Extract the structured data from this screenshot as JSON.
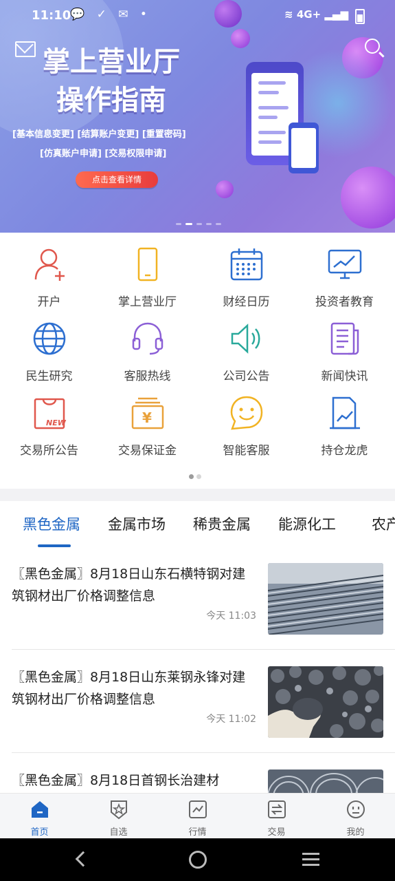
{
  "status_bar": {
    "time": "11:10",
    "left_icons": "💬 ✓ ✉ •",
    "network": "4G+"
  },
  "banner": {
    "title_line1": "掌上营业厅",
    "title_line2": "操作指南",
    "tags_row1": "[基本信息变更] [结算账户变更] [重置密码]",
    "tags_row2": "[仿真账户申请]   [交易权限申请]",
    "button_label": "点击查看详情"
  },
  "quick_menu": [
    {
      "label": "开户",
      "icon": "person-add-icon"
    },
    {
      "label": "掌上营业厅",
      "icon": "mobile-phone-icon"
    },
    {
      "label": "财经日历",
      "icon": "calendar-icon"
    },
    {
      "label": "投资者教育",
      "icon": "monitor-chart-icon"
    },
    {
      "label": "民生研究",
      "icon": "globe-icon"
    },
    {
      "label": "客服热线",
      "icon": "headset-icon"
    },
    {
      "label": "公司公告",
      "icon": "speaker-icon"
    },
    {
      "label": "新闻快讯",
      "icon": "news-icon"
    },
    {
      "label": "交易所公告",
      "icon": "new-bag-icon"
    },
    {
      "label": "交易保证金",
      "icon": "yuan-box-icon"
    },
    {
      "label": "智能客服",
      "icon": "smile-chat-icon"
    },
    {
      "label": "持仓龙虎",
      "icon": "report-chart-icon"
    }
  ],
  "tabs": [
    "黑色金属",
    "金属市场",
    "稀贵金属",
    "能源化工",
    "农产"
  ],
  "news": [
    {
      "title": "〖黑色金属〗8月18日山东石横特钢对建筑钢材出厂价格调整信息",
      "time": "今天 11:03"
    },
    {
      "title": "〖黑色金属〗8月18日山东莱钢永锋对建筑钢材出厂价格调整信息",
      "time": "今天 11:02"
    },
    {
      "title": "〖黑色金属〗8月18日首钢长治建材",
      "time": ""
    }
  ],
  "bottom_nav": [
    {
      "label": "首页",
      "icon": "home-icon"
    },
    {
      "label": "自选",
      "icon": "star-shield-icon"
    },
    {
      "label": "行情",
      "icon": "chart-line-icon"
    },
    {
      "label": "交易",
      "icon": "exchange-icon"
    },
    {
      "label": "我的",
      "icon": "profile-face-icon"
    }
  ],
  "colors": {
    "accent": "#1f66c4",
    "banner_purple": "#8a83e0",
    "button_red": "#e83c3c"
  }
}
